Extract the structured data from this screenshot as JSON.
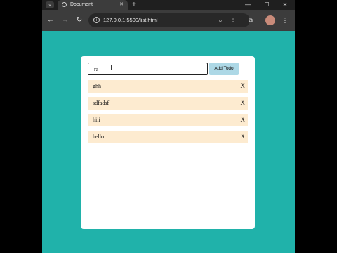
{
  "browser": {
    "tab_title": "Document",
    "url": "127.0.0.1:5500/list.html",
    "icons": {
      "tab_dropdown": "chevron-down-icon",
      "tab_favicon": "globe-icon",
      "tab_close": "close-icon",
      "new_tab": "plus-icon",
      "minimize": "minimize-icon",
      "maximize": "maximize-icon",
      "close_window": "close-icon",
      "back": "arrow-left-icon",
      "forward": "arrow-right-icon",
      "reload": "reload-icon",
      "site_info": "info-icon",
      "zoom": "zoom-icon",
      "bookmark": "star-icon",
      "extensions": "puzzle-icon",
      "menu": "more-vertical-icon"
    }
  },
  "app": {
    "input": {
      "value": "ra"
    },
    "add_button": "Add Todo",
    "todos": [
      {
        "text": "ghh"
      },
      {
        "text": "sdfadsf"
      },
      {
        "text": "hiii"
      },
      {
        "text": "hello"
      }
    ],
    "delete_label": "X"
  },
  "colors": {
    "page_background": "#20b2aa",
    "card": "#ffffff",
    "todo_item": "#fdebd0",
    "add_button": "#add8e6"
  }
}
